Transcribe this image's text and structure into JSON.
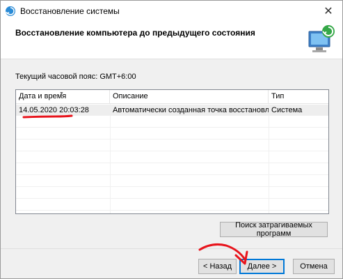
{
  "window": {
    "title": "Восстановление системы",
    "close_glyph": "✕"
  },
  "header": {
    "title": "Восстановление компьютера до предыдущего состояния",
    "icon": "system-restore-icon"
  },
  "timezone_label": "Текущий часовой пояс: GMT+6:00",
  "restore_points": {
    "columns": [
      "Дата и время",
      "Описание",
      "Тип"
    ],
    "sort_column": "Дата и время",
    "rows": [
      {
        "date": "14.05.2020 20:03:28",
        "description": "Автоматически созданная точка восстановле...",
        "type": "Система"
      }
    ]
  },
  "buttons": {
    "scan": "Поиск затрагиваемых программ",
    "back": "< Назад",
    "next": "Далее >",
    "cancel": "Отмена"
  },
  "colors": {
    "annotation": "#e8141c",
    "accent": "#0078d7"
  }
}
